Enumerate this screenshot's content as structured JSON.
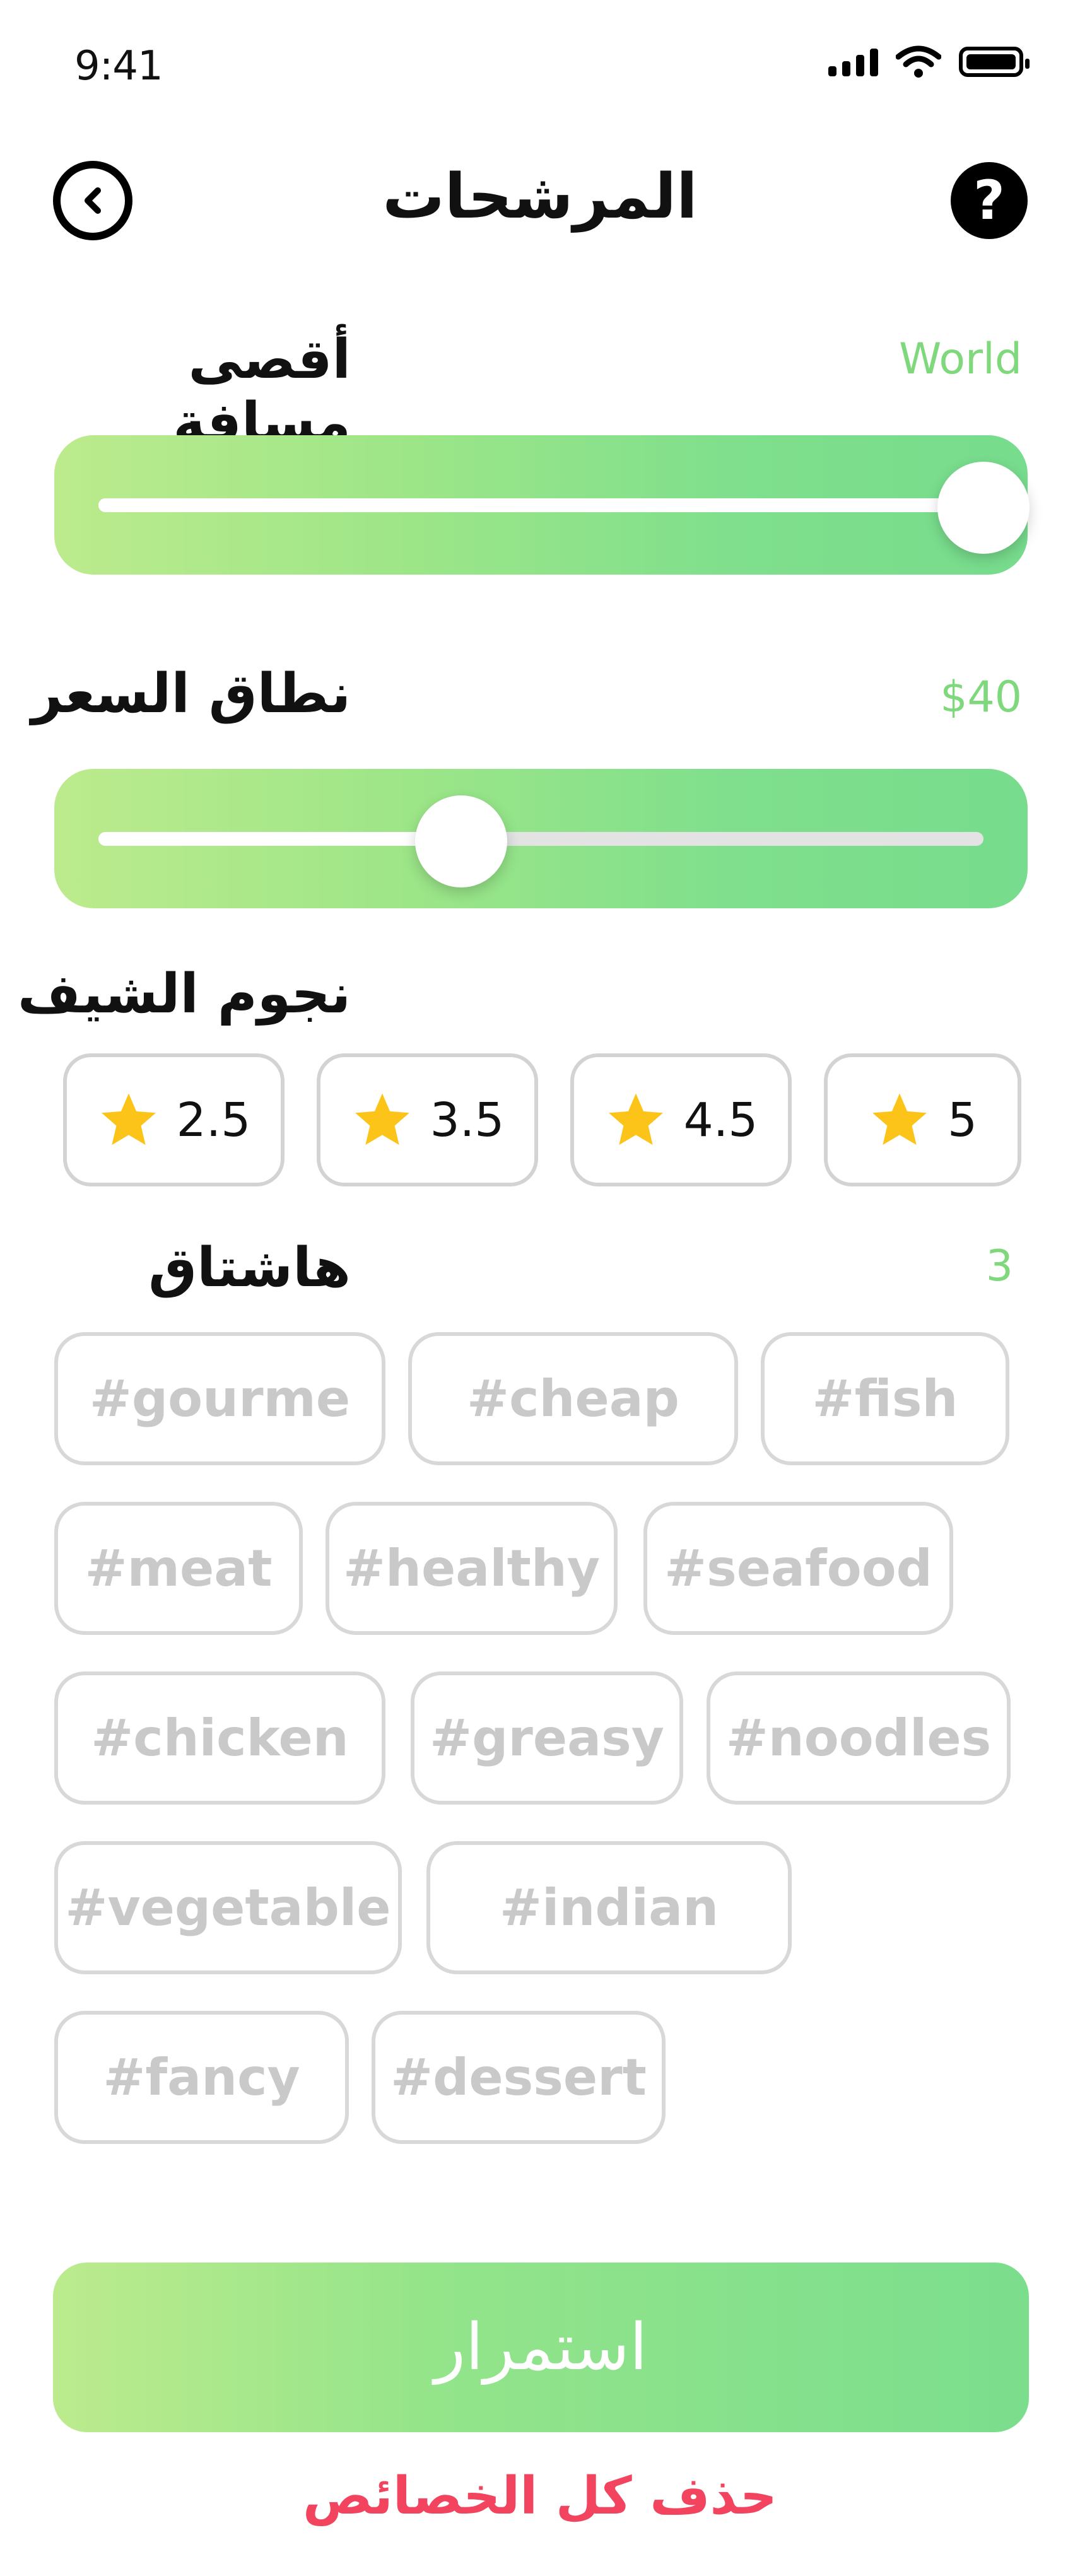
{
  "status_bar": {
    "time": "9:41"
  },
  "header": {
    "title": "المرشحات",
    "back_icon": "chevron-left-circle-icon",
    "help_icon": "question-icon",
    "help_label": "?"
  },
  "distance": {
    "label": "أقصى مسافة",
    "value": "World",
    "level": 1.0
  },
  "price": {
    "label": "نطاق السعر",
    "value": "$40",
    "level": 0.41
  },
  "rating": {
    "label": "نجوم الشيف",
    "options": [
      "2.5",
      "3.5",
      "4.5",
      "5"
    ],
    "star_color": "#fcc419"
  },
  "hashtags": {
    "label": "هاشتاق",
    "count": "3",
    "items": [
      "#gourme",
      "#cheap",
      "#fish",
      "#meat",
      "#healthy",
      "#seafood",
      "#chicken",
      "#greasy",
      "#noodles",
      "#vegetable",
      "#indian",
      "#fancy",
      "#dessert"
    ]
  },
  "footer": {
    "continue_label": "استمرار",
    "clear_label": "حذف كل الخصائص"
  },
  "colors": {
    "accent_green": "#7fd87b",
    "gradient_start": "#bceb8d",
    "gradient_end": "#77dc8d",
    "danger": "#f2445f",
    "chip_border": "#d3d3d3",
    "tag_text": "#c9c9c9"
  }
}
